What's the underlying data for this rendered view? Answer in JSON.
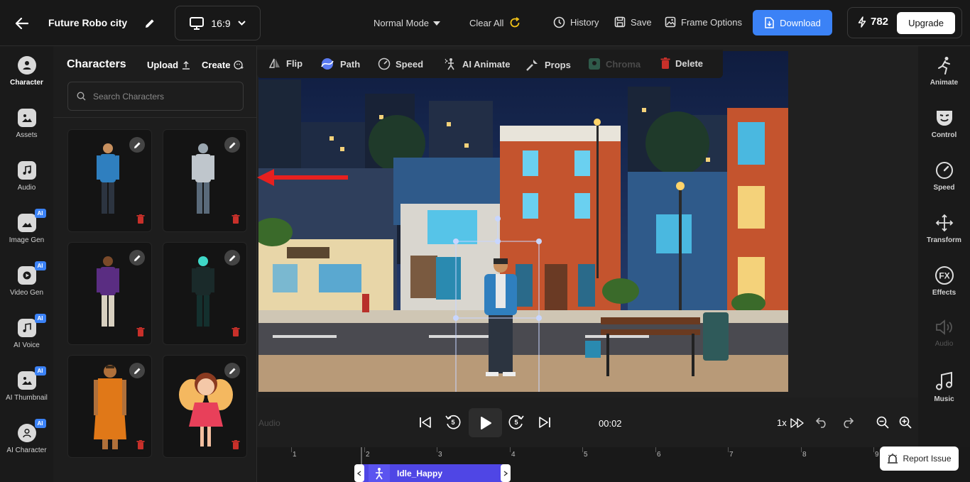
{
  "header": {
    "project_title": "Future Robo city",
    "aspect_ratio": "16:9",
    "mode": "Normal Mode",
    "clear_all": "Clear All",
    "history": "History",
    "save": "Save",
    "frame_options": "Frame Options",
    "download": "Download",
    "credits": "782",
    "upgrade": "Upgrade"
  },
  "left_rail": [
    {
      "label": "Character",
      "icon": "character-icon",
      "ai": false,
      "active": true
    },
    {
      "label": "Assets",
      "icon": "assets-icon",
      "ai": false
    },
    {
      "label": "Audio",
      "icon": "music-note-icon",
      "ai": false
    },
    {
      "label": "Image Gen",
      "icon": "image-icon",
      "ai": true
    },
    {
      "label": "Video Gen",
      "icon": "video-icon",
      "ai": true
    },
    {
      "label": "AI Voice",
      "icon": "voice-icon",
      "ai": true
    },
    {
      "label": "AI Thumbnail",
      "icon": "thumbnail-icon",
      "ai": true
    },
    {
      "label": "AI Character",
      "icon": "ai-character-icon",
      "ai": true
    }
  ],
  "ai_badge": "AI",
  "panel": {
    "title": "Characters",
    "upload": "Upload",
    "create": "Create",
    "search_placeholder": "Search Characters"
  },
  "characters": [
    {
      "name": "man-blue-jacket",
      "colors": {
        "main": "#2f7fbf",
        "pants": "#2c3440",
        "skin": "#c8905e"
      }
    },
    {
      "name": "robot-silver",
      "colors": {
        "main": "#bfc6cc",
        "pants": "#5a6a7a",
        "skin": "#9aa6b0"
      }
    },
    {
      "name": "man-purple-kurta",
      "colors": {
        "main": "#5a2d82",
        "pants": "#d8d0c0",
        "skin": "#7a4a2a"
      }
    },
    {
      "name": "skeleton-cyan-suit",
      "colors": {
        "main": "#1a2a2a",
        "pants": "#14302e",
        "skin": "#3fd8c8"
      }
    },
    {
      "name": "monk-orange-robe",
      "colors": {
        "main": "#e07818",
        "pants": "#e07818",
        "skin": "#b0703a"
      }
    },
    {
      "name": "fairy-pink",
      "colors": {
        "main": "#e8405a",
        "pants": "#f4c0a0",
        "skin": "#f4c8a8"
      }
    }
  ],
  "canvas_toolbar": [
    {
      "label": "Flip",
      "icon": "flip-icon",
      "disabled": false
    },
    {
      "label": "Path",
      "icon": "path-icon",
      "disabled": false
    },
    {
      "label": "Speed",
      "icon": "speed-icon",
      "disabled": false
    },
    {
      "label": "AI Animate",
      "icon": "ai-animate-icon",
      "disabled": false
    },
    {
      "label": "Props",
      "icon": "props-icon",
      "disabled": false
    },
    {
      "label": "Chroma",
      "icon": "chroma-icon",
      "disabled": true
    },
    {
      "label": "Delete",
      "icon": "trash-icon",
      "disabled": false
    }
  ],
  "right_rail": [
    {
      "label": "Animate",
      "icon": "running-man-icon",
      "disabled": false
    },
    {
      "label": "Control",
      "icon": "face-control-icon",
      "disabled": false
    },
    {
      "label": "Speed",
      "icon": "speedometer-icon",
      "disabled": false
    },
    {
      "label": "Transform",
      "icon": "move-arrows-icon",
      "disabled": false
    },
    {
      "label": "Effects",
      "icon": "fx-icon",
      "disabled": false
    },
    {
      "label": "Audio",
      "icon": "speaker-icon",
      "disabled": true
    },
    {
      "label": "Music",
      "icon": "music-notes-icon",
      "disabled": false
    }
  ],
  "playback": {
    "audio_label": "Audio",
    "skip_back": "5",
    "skip_forward": "5",
    "time": "00:02",
    "speed": "1x"
  },
  "timeline": {
    "ticks": [
      "1",
      "2",
      "3",
      "4",
      "5",
      "6",
      "7",
      "8",
      "9"
    ],
    "clip_label": "Idle_Happy"
  },
  "report_issue": "Report Issue",
  "colors": {
    "accent": "#3b82f6",
    "clip": "#4f46e5",
    "arrow": "#e8201f"
  }
}
